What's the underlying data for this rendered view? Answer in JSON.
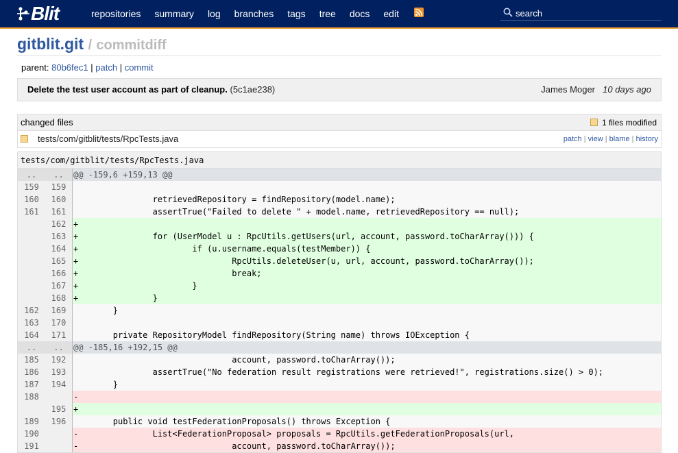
{
  "nav": {
    "logo": "Blit",
    "links": [
      "repositories",
      "summary",
      "log",
      "branches",
      "tags",
      "tree",
      "docs",
      "edit"
    ],
    "search_placeholder": "search"
  },
  "title": {
    "repo": "gitblit.git",
    "separator": "/",
    "page": "commitdiff"
  },
  "parent": {
    "label": "parent:",
    "hash": "80b6fec1",
    "sep1": "|",
    "patch": "patch",
    "sep2": "|",
    "commit": "commit"
  },
  "commit": {
    "message": "Delete the test user account as part of cleanup.",
    "id": "(5c1ae238)",
    "author": "James Moger",
    "date": "10 days ago"
  },
  "changed_files": {
    "label": "changed files",
    "summary": "1 files modified",
    "files": [
      {
        "path": "tests/com/gitblit/tests/RpcTests.java",
        "actions": [
          "patch",
          "view",
          "blame",
          "history"
        ],
        "sep": "|"
      }
    ]
  },
  "diff": {
    "file": "tests/com/gitblit/tests/RpcTests.java",
    "rows": [
      {
        "type": "hunk",
        "old": "..",
        "new": "..",
        "text": "@@ -159,6 +159,13 @@"
      },
      {
        "type": "ctx",
        "old": "159",
        "new": "159",
        "text": ""
      },
      {
        "type": "ctx",
        "old": "160",
        "new": "160",
        "text": "                retrievedRepository = findRepository(model.name);"
      },
      {
        "type": "ctx",
        "old": "161",
        "new": "161",
        "text": "                assertTrue(\"Failed to delete \" + model.name, retrievedRepository == null);"
      },
      {
        "type": "add",
        "old": "",
        "new": "162",
        "text": "+"
      },
      {
        "type": "add",
        "old": "",
        "new": "163",
        "text": "+               for (UserModel u : RpcUtils.getUsers(url, account, password.toCharArray())) {"
      },
      {
        "type": "add",
        "old": "",
        "new": "164",
        "text": "+                       if (u.username.equals(testMember)) {"
      },
      {
        "type": "add",
        "old": "",
        "new": "165",
        "text": "+                               RpcUtils.deleteUser(u, url, account, password.toCharArray());"
      },
      {
        "type": "add",
        "old": "",
        "new": "166",
        "text": "+                               break;"
      },
      {
        "type": "add",
        "old": "",
        "new": "167",
        "text": "+                       }"
      },
      {
        "type": "add",
        "old": "",
        "new": "168",
        "text": "+               }"
      },
      {
        "type": "ctx",
        "old": "162",
        "new": "169",
        "text": "        }"
      },
      {
        "type": "ctx",
        "old": "163",
        "new": "170",
        "text": ""
      },
      {
        "type": "ctx",
        "old": "164",
        "new": "171",
        "text": "        private RepositoryModel findRepository(String name) throws IOException {"
      },
      {
        "type": "hunk",
        "old": "..",
        "new": "..",
        "text": "@@ -185,16 +192,15 @@"
      },
      {
        "type": "ctx",
        "old": "185",
        "new": "192",
        "text": "                                account, password.toCharArray());"
      },
      {
        "type": "ctx",
        "old": "186",
        "new": "193",
        "text": "                assertTrue(\"No federation result registrations were retrieved!\", registrations.size() > 0);"
      },
      {
        "type": "ctx",
        "old": "187",
        "new": "194",
        "text": "        }"
      },
      {
        "type": "del",
        "old": "188",
        "new": "",
        "text": "-"
      },
      {
        "type": "add",
        "old": "",
        "new": "195",
        "text": "+"
      },
      {
        "type": "ctx",
        "old": "189",
        "new": "196",
        "text": "        public void testFederationProposals() throws Exception {"
      },
      {
        "type": "del",
        "old": "190",
        "new": "",
        "text": "-               List<FederationProposal> proposals = RpcUtils.getFederationProposals(url,"
      },
      {
        "type": "del",
        "old": "191",
        "new": "",
        "text": "-                               account, password.toCharArray());"
      }
    ]
  }
}
